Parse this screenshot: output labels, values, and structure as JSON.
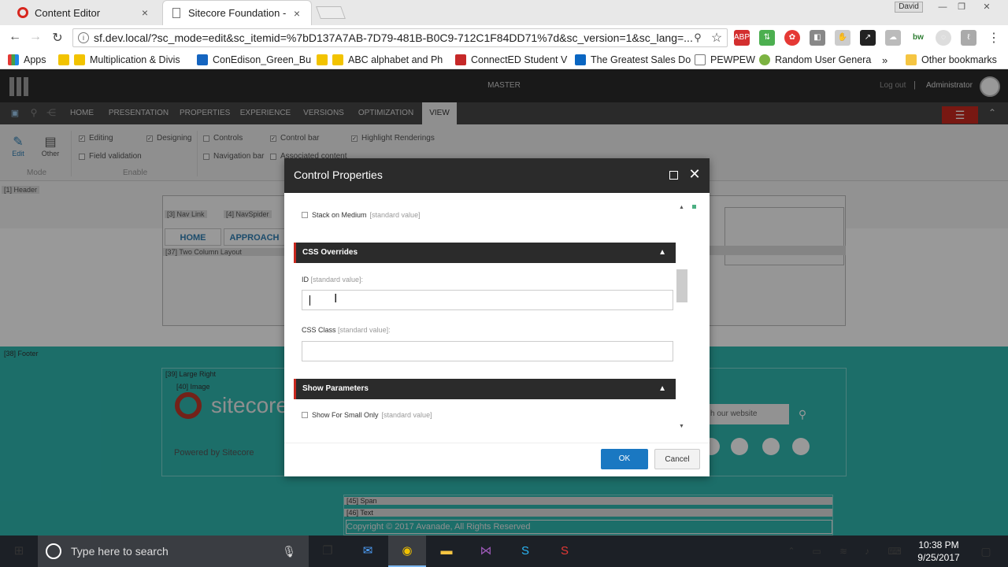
{
  "browser": {
    "tabs": [
      {
        "title": "Content Editor",
        "close": "×"
      },
      {
        "title": "Sitecore Foundation -",
        "close": "×"
      }
    ],
    "user": "David",
    "window_controls": [
      "—",
      "❐",
      "✕"
    ],
    "url": "sf.dev.local/?sc_mode=edit&sc_itemid=%7bD137A7AB-7D79-481B-B0C9-712C1F84DD71%7d&sc_version=1&sc_lang=...",
    "bookmarks": [
      {
        "label": "Apps",
        "color": "#888888"
      },
      {
        "label": "Multiplication & Divis",
        "color": "#f2c300"
      },
      {
        "label": "ConEdison_Green_Bu",
        "color": "#1565c0"
      },
      {
        "label": "ABC alphabet and Ph",
        "color": "#f2c300"
      },
      {
        "label": "ConnectED Student V",
        "color": "#c62828"
      },
      {
        "label": "The Greatest Sales Do",
        "color": "#0a66c2"
      },
      {
        "label": "PEWPEW",
        "color": "#777777"
      },
      {
        "label": "Random User Genera",
        "color": "#7cb342"
      }
    ],
    "more_bookmarks": "»",
    "other_bookmarks": "Other bookmarks"
  },
  "sitecore": {
    "database": "MASTER",
    "logout": "Log out",
    "separator": "|",
    "user": "Administrator",
    "nav_tabs": [
      "HOME",
      "PRESENTATION",
      "PROPERTIES",
      "EXPERIENCE",
      "VERSIONS",
      "OPTIMIZATION",
      "VIEW"
    ],
    "ribbon": {
      "mode_buttons": [
        "Edit",
        "Other"
      ],
      "mode_group": "Mode",
      "enable_group": "Enable",
      "checks": {
        "editing": "Editing",
        "designing": "Designing",
        "field_validation": "Field validation",
        "controls": "Controls",
        "control_bar": "Control bar",
        "highlight_renderings": "Highlight Renderings",
        "navigation_bar": "Navigation bar",
        "associated_content": "Associated content"
      }
    }
  },
  "page": {
    "labels": {
      "header": "[1] Header",
      "nav_link": "[3] Nav Link",
      "nav_spider": "[4] NavSpider",
      "two_column": "[37] Two Column Layout",
      "footer": "[38] Footer",
      "large_right": "[39] Large Right",
      "image": "[40] Image",
      "span": "[45] Span",
      "text": "[46] Text"
    },
    "nav_home": "HOME",
    "nav_approach": "APPROACH",
    "logo_text": "sitecore",
    "powered_by": "Powered by Sitecore",
    "search_placeholder": "h our website",
    "copyright": "Copyright © 2017 Avanade, All Rights Reserved"
  },
  "dialog": {
    "title": "Control Properties",
    "stack_on_medium": "Stack on Medium",
    "standard_value": "[standard value]",
    "css_overrides": "CSS Overrides",
    "id_label": "ID",
    "id_suffix": "[standard value]:",
    "id_value": "",
    "css_class_label": "CSS Class",
    "css_class_suffix": "[standard value]:",
    "css_class_value": "",
    "show_parameters": "Show Parameters",
    "show_small_only": "Show For Small Only",
    "ok": "OK",
    "cancel": "Cancel"
  },
  "taskbar": {
    "search_placeholder": "Type here to search",
    "time": "10:38 PM",
    "date": "9/25/2017"
  },
  "colors": {
    "accent_red": "#c8281e",
    "ok_blue": "#1a78c2",
    "teal": "#2fb7b0",
    "dark": "#2b2b2b"
  }
}
